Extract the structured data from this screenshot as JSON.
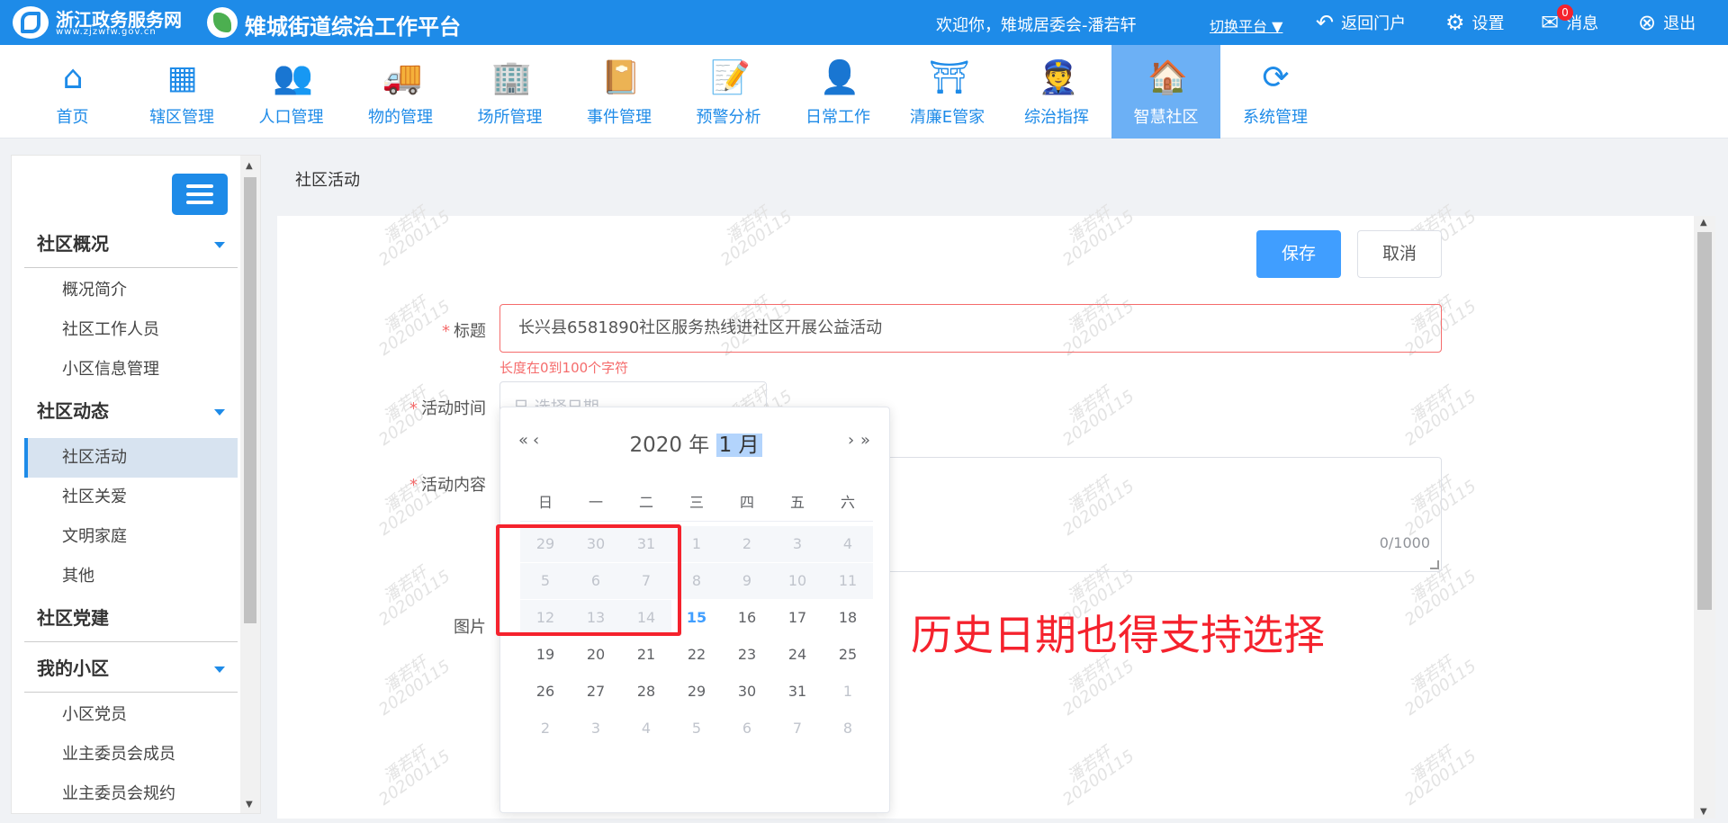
{
  "header": {
    "brand_title": "浙江政务服务网",
    "brand_url": "www.zjzwfw.gov.cn",
    "platform_title": "雉城街道综治工作平台",
    "welcome": "欢迎你，雉城居委会-潘若轩",
    "switch_platform": "切换平台 ▼",
    "return_portal": "返回门户",
    "settings": "设置",
    "messages": "消息",
    "message_count": "0",
    "logout": "退出"
  },
  "nav": [
    {
      "label": "首页",
      "icon": "home-icon",
      "glyph": "⌂"
    },
    {
      "label": "辖区管理",
      "icon": "grid-icon",
      "glyph": "▦"
    },
    {
      "label": "人口管理",
      "icon": "people-icon",
      "glyph": "👥"
    },
    {
      "label": "物的管理",
      "icon": "truck-icon",
      "glyph": "🚚"
    },
    {
      "label": "场所管理",
      "icon": "building-icon",
      "glyph": "🏢"
    },
    {
      "label": "事件管理",
      "icon": "book-icon",
      "glyph": "📔"
    },
    {
      "label": "预警分析",
      "icon": "report-icon",
      "glyph": "📝"
    },
    {
      "label": "日常工作",
      "icon": "worker-icon",
      "glyph": "👤"
    },
    {
      "label": "清廉E管家",
      "icon": "pavilion-icon",
      "glyph": "⛩"
    },
    {
      "label": "综治指挥",
      "icon": "officer-icon",
      "glyph": "👮"
    },
    {
      "label": "智慧社区",
      "icon": "heart-house-icon",
      "glyph": "🏠"
    },
    {
      "label": "系统管理",
      "icon": "network-icon",
      "glyph": "⟳"
    }
  ],
  "sidebar": {
    "sections": [
      {
        "title": "社区概况",
        "items": [
          "概况简介",
          "社区工作人员",
          "小区信息管理"
        ]
      },
      {
        "title": "社区动态",
        "items": [
          "社区活动",
          "社区关爱",
          "文明家庭",
          "其他"
        ]
      },
      {
        "title": "社区党建",
        "items": []
      },
      {
        "title": "我的小区",
        "items": [
          "小区党员",
          "业主委员会成员",
          "业主委员会规约"
        ]
      }
    ],
    "active_item": "社区活动"
  },
  "breadcrumb": "社区活动",
  "form": {
    "save_label": "保存",
    "cancel_label": "取消",
    "title_label": "标题",
    "title_value": "长兴县6581890社区服务热线进社区开展公益活动",
    "title_error": "长度在0到100个字符",
    "time_label": "活动时间",
    "time_placeholder": "日 选择日期",
    "content_label": "活动内容",
    "content_count": "0/1000",
    "image_label": "图片"
  },
  "datepicker": {
    "year": "2020 年",
    "month": "1 月",
    "prev_year": "«",
    "prev_month": "‹",
    "next_month": "›",
    "next_year": "»",
    "weekdays": [
      "日",
      "一",
      "二",
      "三",
      "四",
      "五",
      "六"
    ],
    "weeks": [
      [
        {
          "d": "29",
          "s": "dim"
        },
        {
          "d": "30",
          "s": "dim"
        },
        {
          "d": "31",
          "s": "dim"
        },
        {
          "d": "1",
          "s": "dim"
        },
        {
          "d": "2",
          "s": "dim"
        },
        {
          "d": "3",
          "s": "dim"
        },
        {
          "d": "4",
          "s": "dim"
        }
      ],
      [
        {
          "d": "5",
          "s": "dim"
        },
        {
          "d": "6",
          "s": "dim"
        },
        {
          "d": "7",
          "s": "dim"
        },
        {
          "d": "8",
          "s": "dim"
        },
        {
          "d": "9",
          "s": "dim"
        },
        {
          "d": "10",
          "s": "dim"
        },
        {
          "d": "11",
          "s": "dim"
        }
      ],
      [
        {
          "d": "12",
          "s": "dim"
        },
        {
          "d": "13",
          "s": "dim"
        },
        {
          "d": "14",
          "s": "dim"
        },
        {
          "d": "15",
          "s": "today"
        },
        {
          "d": "16",
          "s": ""
        },
        {
          "d": "17",
          "s": ""
        },
        {
          "d": "18",
          "s": ""
        }
      ],
      [
        {
          "d": "19",
          "s": ""
        },
        {
          "d": "20",
          "s": ""
        },
        {
          "d": "21",
          "s": ""
        },
        {
          "d": "22",
          "s": ""
        },
        {
          "d": "23",
          "s": ""
        },
        {
          "d": "24",
          "s": ""
        },
        {
          "d": "25",
          "s": ""
        }
      ],
      [
        {
          "d": "26",
          "s": ""
        },
        {
          "d": "27",
          "s": ""
        },
        {
          "d": "28",
          "s": ""
        },
        {
          "d": "29",
          "s": ""
        },
        {
          "d": "30",
          "s": ""
        },
        {
          "d": "31",
          "s": ""
        },
        {
          "d": "1",
          "s": "dim"
        }
      ],
      [
        {
          "d": "2",
          "s": "dim"
        },
        {
          "d": "3",
          "s": "dim"
        },
        {
          "d": "4",
          "s": "dim"
        },
        {
          "d": "5",
          "s": "dim"
        },
        {
          "d": "6",
          "s": "dim"
        },
        {
          "d": "7",
          "s": "dim"
        },
        {
          "d": "8",
          "s": "dim"
        }
      ]
    ]
  },
  "annotation": "历史日期也得支持选择",
  "watermark": {
    "name": "潘若轩",
    "date": "20200115"
  },
  "colors": {
    "primary": "#1e8be8",
    "accent": "#409eff",
    "error": "#f56c6c",
    "annotation": "#f5222d"
  }
}
